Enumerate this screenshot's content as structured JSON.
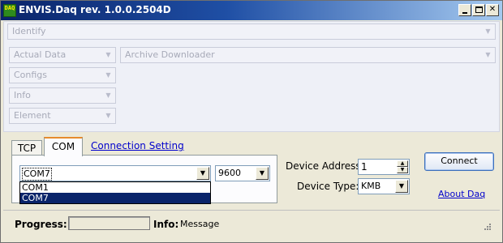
{
  "window": {
    "icon_text": "DAQ",
    "title": "ENVIS.Daq rev. 1.0.0.2504D",
    "controls": {
      "minimize": "_",
      "maximize": "□",
      "close": "✕"
    }
  },
  "modules": {
    "identify": "Identify",
    "actual_data": "Actual Data",
    "archive_downloader": "Archive Downloader",
    "configs": "Configs",
    "info": "Info",
    "element": "Element",
    "arrow_glyph": "▼"
  },
  "tabs": [
    {
      "label": "TCP",
      "active": false
    },
    {
      "label": "COM",
      "active": true
    }
  ],
  "connection_setting_link": "Connection Setting",
  "com": {
    "port_value": "COM7",
    "port_options": [
      "COM1",
      "COM7"
    ],
    "port_selected_index": 1,
    "baud_value": "9600"
  },
  "device": {
    "address_label": "Device Address:",
    "address_value": "1",
    "type_label": "Device Type:",
    "type_value": "KMB"
  },
  "buttons": {
    "connect": "Connect",
    "about": "About Daq"
  },
  "status": {
    "progress_label": "Progress:",
    "progress_fraction": 0,
    "info_label": "Info:",
    "info_message": "Message"
  },
  "colors": {
    "title_gradient_start": "#0a246a",
    "title_gradient_end": "#a6caf0",
    "selection": "#0a246a",
    "link": "#0000cc",
    "tab_accent": "#e68b2c"
  }
}
